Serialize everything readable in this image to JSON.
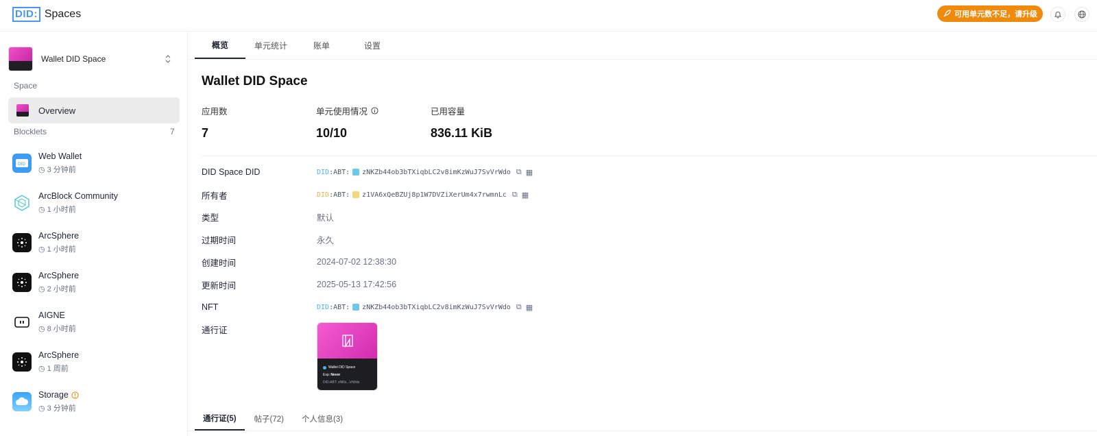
{
  "header": {
    "logo_box": "DID:",
    "logo_text": "Spaces",
    "upgrade_label": "可用单元数不足，请升级",
    "colors": {
      "accent": "#4598fa",
      "upgrade": "#ef8a0d"
    },
    "icons": [
      "rocket-icon",
      "bell-icon",
      "globe-icon"
    ]
  },
  "sidebar": {
    "space_name": "Wallet DID Space",
    "space_section": "Space",
    "overview_label": "Overview",
    "blocklets_label": "Blocklets",
    "blocklets_count": "7",
    "items": [
      {
        "name": "Web Wallet",
        "time": "3 分钟前",
        "icon": "web-wallet-icon"
      },
      {
        "name": "ArcBlock Community",
        "time": "1 小时前",
        "icon": "arcblock-community-icon"
      },
      {
        "name": "ArcSphere",
        "time": "1 小时前",
        "icon": "arcsphere-icon"
      },
      {
        "name": "ArcSphere",
        "time": "2 小时前",
        "icon": "arcsphere-icon"
      },
      {
        "name": "AIGNE",
        "time": "8 小时前",
        "icon": "aigne-icon"
      },
      {
        "name": "ArcSphere",
        "time": "1 周前",
        "icon": "arcsphere-icon"
      },
      {
        "name": "Storage",
        "time": "3 分钟前",
        "icon": "storage-icon"
      }
    ]
  },
  "tabs": [
    "概览",
    "单元统计",
    "账单",
    "设置"
  ],
  "main": {
    "title": "Wallet DID Space",
    "stats": [
      {
        "label": "应用数",
        "value": "7"
      },
      {
        "label": "单元使用情况",
        "value": "10/10"
      },
      {
        "label": "已用容量",
        "value": "836.11 KiB"
      }
    ],
    "details": {
      "did_label": "DID Space DID",
      "did_prefix": "DID",
      "did_abt": ":ABT:",
      "did_value": "zNKZb44ob3bTXiqbLC2v8imKzWuJ7SvVrWdo",
      "owner_label": "所有者",
      "owner_value": "z1VA6xQeBZUj8p1W7DVZiXerUm4x7rwmnLc",
      "type_label": "类型",
      "type_value": "默认",
      "expire_label": "过期时间",
      "expire_value": "永久",
      "created_label": "创建时间",
      "created_value": "2024-07-02 12:38:30",
      "updated_label": "更新时间",
      "updated_value": "2025-05-13 17:42:56",
      "nft_label": "NFT",
      "nft_value": "zNKZb44ob3bTXiqbLC2v8imKzWuJ7SvVrWdo",
      "pass_label": "通行证"
    },
    "nft_card": {
      "name": "Wallet DID Space",
      "exp_label": "Exp:",
      "exp_value": "Never",
      "did_short": "DID:ABT:  zNKb...VrWdo"
    },
    "bottom_tabs": [
      "通行证(5)",
      "帖子(72)",
      "个人信息(3)"
    ]
  }
}
